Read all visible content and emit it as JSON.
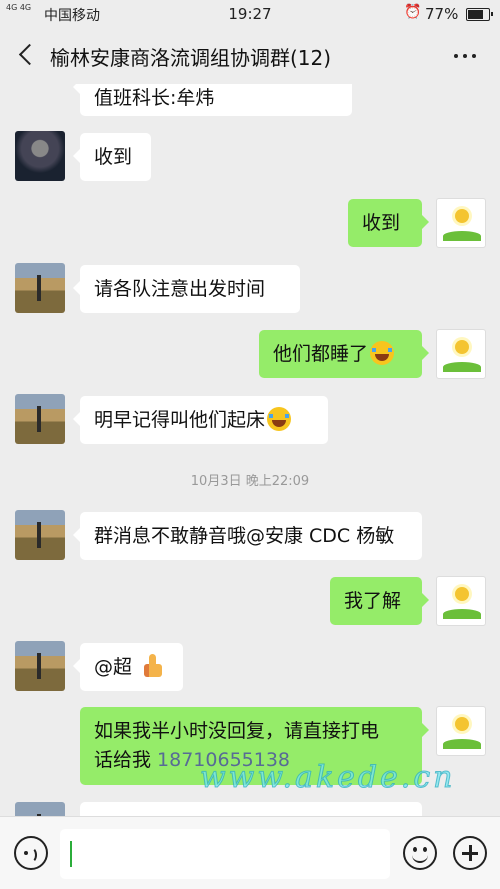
{
  "status_bar": {
    "signal": "4G 4G",
    "carrier": "中国移动",
    "time": "19:27",
    "alarm_icon": "alarm-icon",
    "battery": "77%",
    "battery_level": 0.77
  },
  "header": {
    "title": "榆林安康商洛流调组协调群(12)",
    "back_icon": "back-arrow-icon",
    "more_icon": "more-dots-icon"
  },
  "messages": [
    {
      "side": "left",
      "text": "值班科长:牟炜"
    },
    {
      "side": "left",
      "text": "收到"
    },
    {
      "side": "right",
      "text": "收到"
    },
    {
      "side": "left",
      "text": "请各队注意出发时间"
    },
    {
      "side": "right",
      "text": "他们都睡了",
      "emoji": "laughing-tears-emoji"
    },
    {
      "side": "left",
      "text": "明早记得叫他们起床",
      "emoji": "laughing-tears-emoji"
    },
    {
      "side": "left",
      "text": "群消息不敢静音哦@安康 CDC 杨敏"
    },
    {
      "side": "right",
      "text": "我了解"
    },
    {
      "side": "left",
      "text": "@超",
      "emoji": "thumbs-up-emoji"
    },
    {
      "side": "right",
      "text_line1": "如果我半小时没回复，请直接打电",
      "text_line2_prefix": "话给我 ",
      "phone": "18710655138"
    }
  ],
  "timestamp": "10月3日 晚上22:09",
  "watermark": "www.akede.cn",
  "bottom_bar": {
    "voice_icon": "voice-icon",
    "emoji_icon": "emoji-icon",
    "plus_icon": "plus-icon"
  },
  "colors": {
    "background": "#ededed",
    "bubble_self": "#95ec69",
    "bubble_other": "#ffffff",
    "link": "#576b95"
  }
}
